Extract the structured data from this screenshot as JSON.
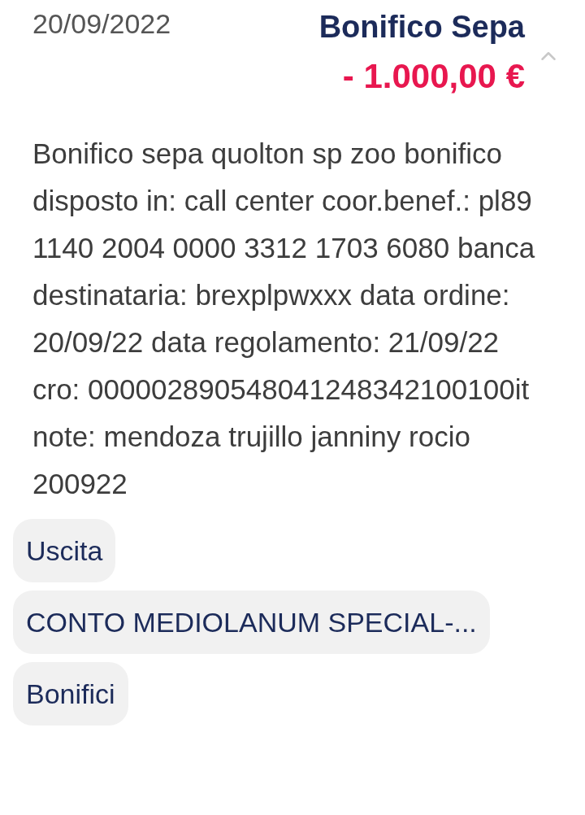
{
  "transaction": {
    "date": "20/09/2022",
    "title": "Bonifico Sepa",
    "amount": "- 1.000,00 €",
    "expanded": true,
    "description": "Bonifico sepa quolton sp zoo bonifico disposto in: call center coor.benef.: pl89 1140 2004 0000 3312 1703 6080 banca destinataria: brexplpwxxx data ordine: 20/09/22 data regolamento: 21/09/22 cro: 000002890548041248342100100it note: mendoza trujillo janniny rocio 200922"
  },
  "tags": [
    "Uscita",
    "CONTO MEDIOLANUM SPECIAL-...",
    "Bonifici"
  ]
}
